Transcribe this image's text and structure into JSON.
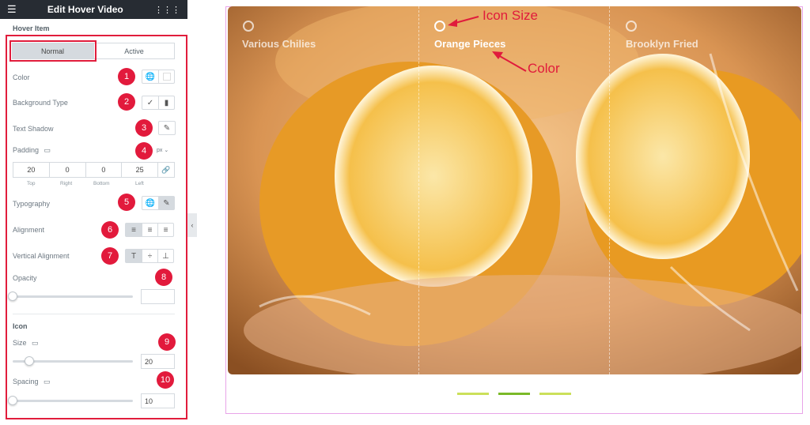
{
  "header": {
    "title": "Edit Hover Video",
    "menu_icon": "hamburger-icon",
    "grid_icon": "grid-icon"
  },
  "section": {
    "title": "Hover Item"
  },
  "tabs": [
    {
      "label": "Normal"
    },
    {
      "label": "Active"
    }
  ],
  "fields": {
    "color": "Color",
    "background_type": "Background Type",
    "text_shadow": "Text Shadow",
    "padding": "Padding",
    "padding_unit": "px",
    "typography": "Typography",
    "alignment": "Alignment",
    "vertical_alignment": "Vertical Alignment",
    "opacity": "Opacity"
  },
  "padding_values": {
    "top": "20",
    "right": "0",
    "bottom": "0",
    "left": "25"
  },
  "padding_labels": {
    "top": "Top",
    "right": "Right",
    "bottom": "Bottom",
    "left": "Left"
  },
  "icon_section": {
    "title": "Icon",
    "size_label": "Size",
    "size_value": "20",
    "spacing_label": "Spacing",
    "spacing_value": "10"
  },
  "badges": [
    "1",
    "2",
    "3",
    "4",
    "5",
    "6",
    "7",
    "8",
    "9",
    "10"
  ],
  "preview": {
    "items": [
      "Various Chilies",
      "Orange Pieces",
      "Brooklyn Fried"
    ],
    "annotations": {
      "icon_size": "Icon Size",
      "color": "Color"
    }
  },
  "colors": {
    "panel_header": "#272c33",
    "highlight": "#e11d3c",
    "badge": "#e21a3c",
    "accent_green": "#7ab928"
  }
}
